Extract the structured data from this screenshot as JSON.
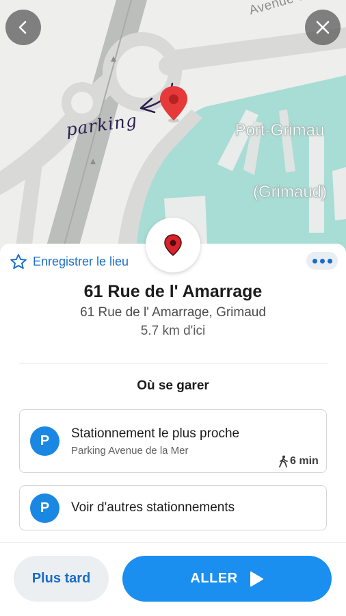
{
  "map": {
    "street_label": "Avenue de la",
    "place_label_line1": "Port-Grimau",
    "place_label_line2": "(Grimaud)",
    "handwritten_note": "parking",
    "back_icon": "chevron-left-icon",
    "close_icon": "close-icon",
    "pin_icon": "map-pin-icon",
    "colors": {
      "land": "#eeeeec",
      "water": "#a7ddd5",
      "roads": "#d9dad8",
      "pin": "#e5393a"
    }
  },
  "sheet": {
    "save_label": "Enregistrer le lieu",
    "save_icon": "star-outline-icon",
    "more_icon": "more-horizontal-icon",
    "title": "61 Rue de l' Amarrage",
    "subtitle": "61 Rue de l' Amarrage, Grimaud",
    "distance": "5.7 km d'ici",
    "section_title": "Où se garer",
    "parking": [
      {
        "badge": "P",
        "title": "Stationnement le plus proche",
        "subtitle": "Parking Avenue de la Mer",
        "walk_time": "6 min",
        "walk_icon": "walking-person-icon"
      },
      {
        "badge": "P",
        "title": "Voir d'autres stationnements"
      }
    ]
  },
  "actions": {
    "later_label": "Plus tard",
    "go_label": "ALLER",
    "go_icon": "play-icon",
    "colors": {
      "primary": "#1b8ff0",
      "link": "#1a6cc7",
      "secondary_bg": "#eceff2"
    }
  }
}
